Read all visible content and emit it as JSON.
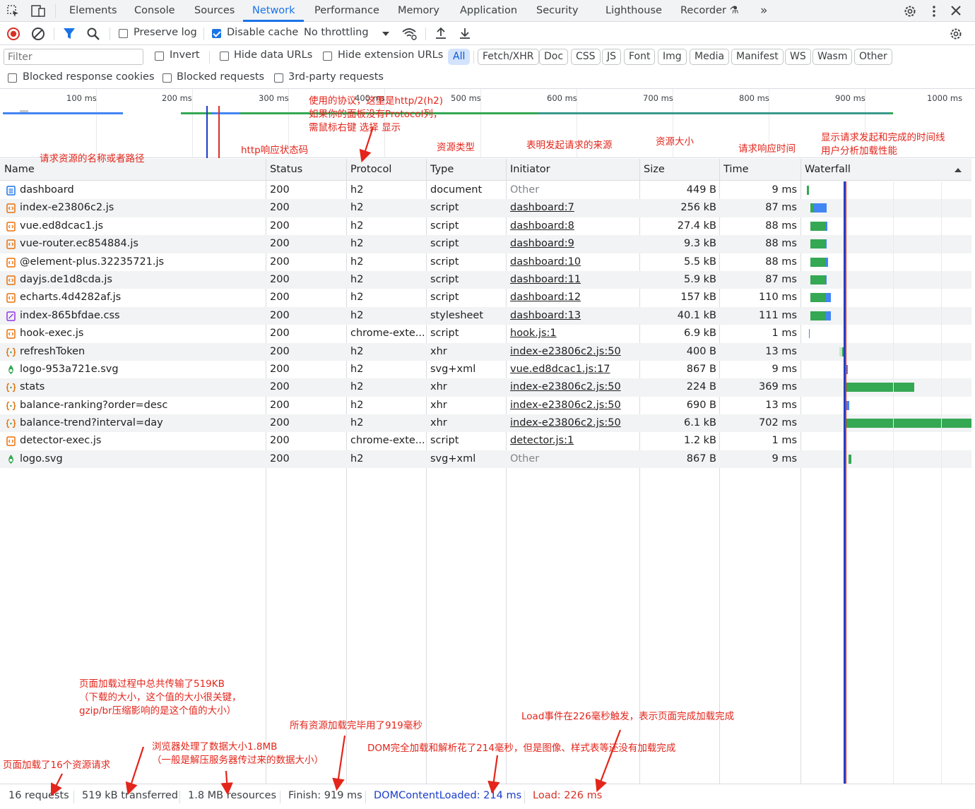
{
  "tabs": {
    "elements": "Elements",
    "console": "Console",
    "sources": "Sources",
    "network": "Network",
    "performance": "Performance",
    "memory": "Memory",
    "application": "Application",
    "security": "Security",
    "lighthouse": "Lighthouse",
    "recorder": "Recorder",
    "more": "»"
  },
  "toolbar": {
    "preserve_log": "Preserve log",
    "preserve_log_checked": false,
    "disable_cache": "Disable cache",
    "disable_cache_checked": true,
    "throttling": "No throttling"
  },
  "filterbar": {
    "filter_placeholder": "Filter",
    "invert": "Invert",
    "hide_data_urls": "Hide data URLs",
    "hide_extension_urls": "Hide extension URLs",
    "types": [
      "All",
      "Fetch/XHR",
      "Doc",
      "CSS",
      "JS",
      "Font",
      "Img",
      "Media",
      "Manifest",
      "WS",
      "Wasm",
      "Other"
    ],
    "selected_type": "All"
  },
  "options": {
    "blocked_response_cookies": "Blocked response cookies",
    "blocked_requests": "Blocked requests",
    "third_party_requests": "3rd-party requests"
  },
  "overview": {
    "ticks": [
      "100 ms",
      "200 ms",
      "300 ms",
      "400 ms",
      "500 ms",
      "600 ms",
      "700 ms",
      "800 ms",
      "900 ms",
      "1000 ms"
    ]
  },
  "columns": {
    "name": "Name",
    "status": "Status",
    "protocol": "Protocol",
    "type": "Type",
    "initiator": "Initiator",
    "size": "Size",
    "time": "Time",
    "waterfall": "Waterfall"
  },
  "requests": [
    {
      "name": "dashboard",
      "status": "200",
      "protocol": "h2",
      "type": "document",
      "initiator": "Other",
      "size": "449 B",
      "time": "9 ms"
    },
    {
      "name": "index-e23806c2.js",
      "status": "200",
      "protocol": "h2",
      "type": "script",
      "initiator": "dashboard:7",
      "size": "256 kB",
      "time": "87 ms"
    },
    {
      "name": "vue.ed8dcac1.js",
      "status": "200",
      "protocol": "h2",
      "type": "script",
      "initiator": "dashboard:8",
      "size": "27.4 kB",
      "time": "88 ms"
    },
    {
      "name": "vue-router.ec854884.js",
      "status": "200",
      "protocol": "h2",
      "type": "script",
      "initiator": "dashboard:9",
      "size": "9.3 kB",
      "time": "88 ms"
    },
    {
      "name": "@element-plus.32235721.js",
      "status": "200",
      "protocol": "h2",
      "type": "script",
      "initiator": "dashboard:10",
      "size": "5.5 kB",
      "time": "88 ms"
    },
    {
      "name": "dayjs.de1d8cda.js",
      "status": "200",
      "protocol": "h2",
      "type": "script",
      "initiator": "dashboard:11",
      "size": "5.9 kB",
      "time": "87 ms"
    },
    {
      "name": "echarts.4d4282af.js",
      "status": "200",
      "protocol": "h2",
      "type": "script",
      "initiator": "dashboard:12",
      "size": "157 kB",
      "time": "110 ms"
    },
    {
      "name": "index-865bfdae.css",
      "status": "200",
      "protocol": "h2",
      "type": "stylesheet",
      "initiator": "dashboard:13",
      "size": "40.1 kB",
      "time": "111 ms"
    },
    {
      "name": "hook-exec.js",
      "status": "200",
      "protocol": "chrome-exte...",
      "type": "script",
      "initiator": "hook.js:1",
      "size": "6.9 kB",
      "time": "1 ms"
    },
    {
      "name": "refreshToken",
      "status": "200",
      "protocol": "h2",
      "type": "xhr",
      "initiator": "index-e23806c2.js:50",
      "size": "400 B",
      "time": "13 ms"
    },
    {
      "name": "logo-953a721e.svg",
      "status": "200",
      "protocol": "h2",
      "type": "svg+xml",
      "initiator": "vue.ed8dcac1.js:17",
      "size": "867 B",
      "time": "9 ms"
    },
    {
      "name": "stats",
      "status": "200",
      "protocol": "h2",
      "type": "xhr",
      "initiator": "index-e23806c2.js:50",
      "size": "224 B",
      "time": "369 ms"
    },
    {
      "name": "balance-ranking?order=desc",
      "status": "200",
      "protocol": "h2",
      "type": "xhr",
      "initiator": "index-e23806c2.js:50",
      "size": "690 B",
      "time": "13 ms"
    },
    {
      "name": "balance-trend?interval=day",
      "status": "200",
      "protocol": "h2",
      "type": "xhr",
      "initiator": "index-e23806c2.js:50",
      "size": "6.1 kB",
      "time": "702 ms"
    },
    {
      "name": "detector-exec.js",
      "status": "200",
      "protocol": "chrome-exte...",
      "type": "script",
      "initiator": "detector.js:1",
      "size": "1.2 kB",
      "time": "1 ms"
    },
    {
      "name": "logo.svg",
      "status": "200",
      "protocol": "h2",
      "type": "svg+xml",
      "initiator": "Other",
      "size": "867 B",
      "time": "9 ms"
    }
  ],
  "statusbar": {
    "requests": "16 requests",
    "transferred": "519 kB transferred",
    "resources": "1.8 MB resources",
    "finish": "Finish: 919 ms",
    "dom_content_loaded": "DOMContentLoaded: 214 ms",
    "load": "Load: 226 ms"
  },
  "annotations": {
    "protocol_note": [
      "使用的协议，这里是http/2(h2)",
      "如果你的面板没有Protocol列，",
      "需鼠标右键 选择 显示"
    ],
    "name_note": "请求资源的名称或者路径",
    "status_note": "http响应状态码",
    "type_note": "资源类型",
    "initiator_note": "表明发起请求的来源",
    "size_note": "资源大小",
    "time_note": "请求响应时间",
    "waterfall_note": [
      "显示请求发起和完成的时间线",
      "用户分析加载性能"
    ],
    "transferred_note": [
      "页面加载过程中总共传输了519KB",
      "（下载的大小，这个值的大小很关键，",
      "gzip/br压缩影响的是这个值的大小）"
    ],
    "finish_note": "所有资源加载完毕用了919毫秒",
    "load_note": "Load事件在226毫秒触发，表示页面完成加载完成",
    "resources_note": [
      "浏览器处理了数据大小1.8MB",
      "（一般是解压服务器传过来的数据大小）"
    ],
    "dcl_note": "DOM完全加载和解析花了214毫秒，但是图像、样式表等还没有加载完成",
    "requests_note": "页面加载了16个资源请求"
  },
  "colors": {
    "accent": "#1a73e8",
    "annotation": "#e3251b",
    "dcl_line": "#1a3cc8",
    "load_line": "#d93025",
    "bar_waiting": "#34a853",
    "bar_download": "#4285f4"
  }
}
